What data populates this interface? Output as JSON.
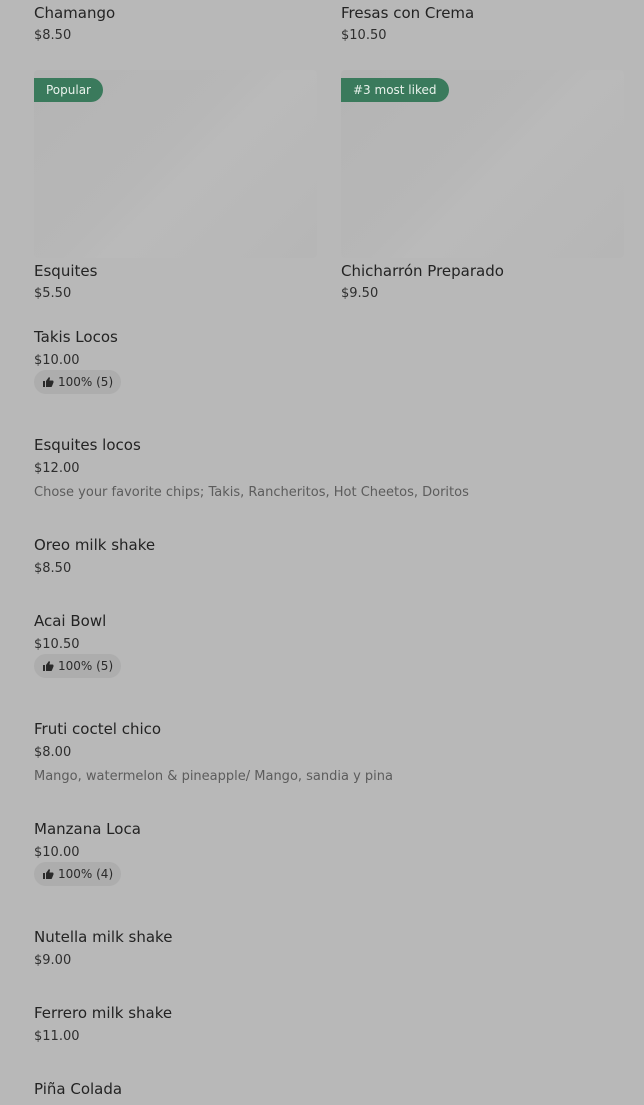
{
  "grid": [
    {
      "name": "Chamango",
      "price": "$8.50"
    },
    {
      "name": "Fresas con Crema",
      "price": "$10.50"
    },
    {
      "name": "Esquites",
      "price": "$5.50",
      "badge": "Popular"
    },
    {
      "name": "Chicharrón Preparado",
      "price": "$9.50",
      "badge": "#3 most liked"
    }
  ],
  "items": [
    {
      "name": "Takis Locos",
      "price": "$10.00",
      "rating": "100% (5)"
    },
    {
      "name": "Esquites locos",
      "price": "$12.00",
      "description": "Chose your favorite chips; Takis, Rancheritos, Hot Cheetos, Doritos"
    },
    {
      "name": "Oreo milk shake",
      "price": "$8.50"
    },
    {
      "name": "Acai Bowl",
      "price": "$10.50",
      "rating": "100% (5)"
    },
    {
      "name": "Fruti coctel chico",
      "price": "$8.00",
      "description": "Mango, watermelon & pineapple/ Mango, sandia y pina"
    },
    {
      "name": "Manzana Loca",
      "price": "$10.00",
      "rating": "100% (4)"
    },
    {
      "name": "Nutella milk shake",
      "price": "$9.00"
    },
    {
      "name": "Ferrero milk shake",
      "price": "$11.00"
    },
    {
      "name": "Piña Colada",
      "price": ""
    }
  ],
  "colors": {
    "badge": "#3a7a5c",
    "overlay": "#b8b8b8"
  },
  "icons": {
    "rating": "thumbs-up-icon"
  }
}
